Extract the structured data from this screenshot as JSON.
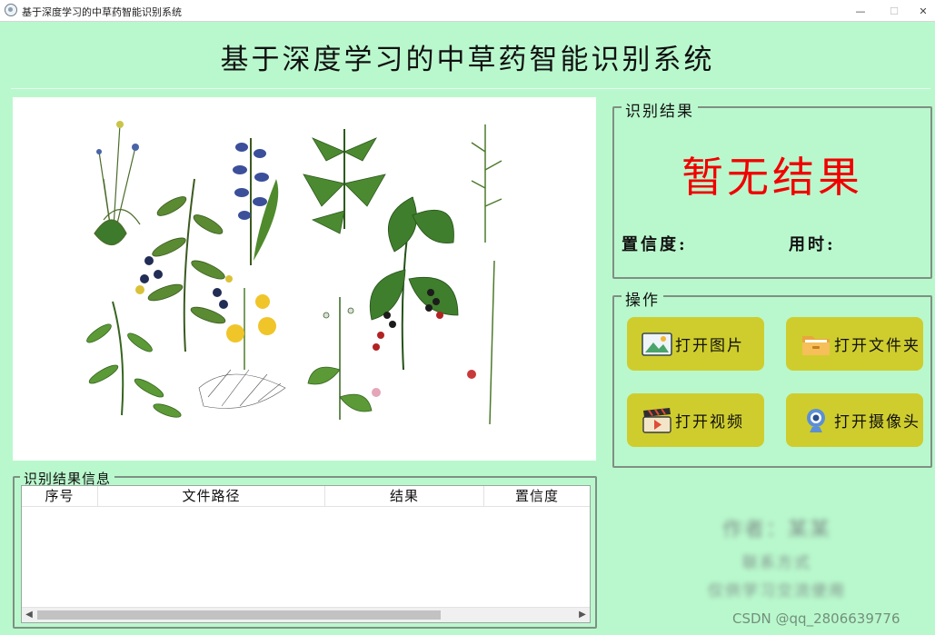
{
  "window": {
    "title": "基于深度学习的中草药智能识别系统",
    "minimize": "—",
    "maximize": "☐",
    "close": "✕"
  },
  "page_title": "基于深度学习的中草药智能识别系统",
  "result_panel": {
    "title": "识别结果",
    "result_text": "暂无结果",
    "confidence_label": "置信度:",
    "time_label": "用时:"
  },
  "operations": {
    "title": "操作",
    "buttons": [
      {
        "label": "打开图片",
        "icon": "image-icon"
      },
      {
        "label": "打开文件夹",
        "icon": "folder-icon"
      },
      {
        "label": "打开视频",
        "icon": "video-icon"
      },
      {
        "label": "打开摄像头",
        "icon": "webcam-icon"
      }
    ]
  },
  "results_info": {
    "title": "识别结果信息",
    "columns": [
      "序号",
      "文件路径",
      "结果",
      "置信度"
    ],
    "rows": []
  },
  "author": {
    "line1": "作者：某某",
    "line2": "联系方式",
    "line3": "仅供学习交流使用"
  },
  "watermark": "CSDN @qq_2806639776",
  "colors": {
    "background": "#b9f8cd",
    "button": "#cfcd2d",
    "result_text": "#f10000"
  }
}
